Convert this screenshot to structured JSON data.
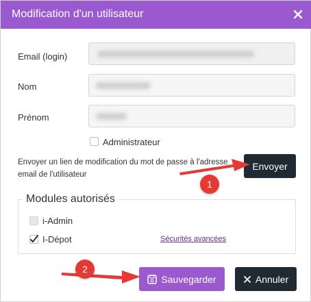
{
  "modal": {
    "title": "Modification d'un utilisateur",
    "close_icon": "close-icon"
  },
  "form": {
    "email_label": "Email (login)",
    "nom_label": "Nom",
    "prenom_label": "Prénom",
    "admin_label": "Administrateur",
    "send_text": "Envoyer un lien de modification du mot de passe à l'adresse email de l'utilisateur",
    "send_button": "Envoyer"
  },
  "modules": {
    "title": "Modules autorisés",
    "items": [
      {
        "label": "i-Admin",
        "checked": false,
        "disabled": true
      },
      {
        "label": "I-Dépot",
        "checked": true,
        "disabled": false
      }
    ],
    "link": "Sécurités avancées"
  },
  "footer": {
    "save_label": "Sauvegarder",
    "save_icon": "save-icon",
    "cancel_label": "Annuler",
    "cancel_icon": "close-icon"
  },
  "annotations": {
    "badge1": "1",
    "badge2": "2",
    "color": "#e53935"
  },
  "colors": {
    "header": "#9b59d0",
    "dark_button": "#1f2a33",
    "purple_button": "#9b59d0"
  }
}
